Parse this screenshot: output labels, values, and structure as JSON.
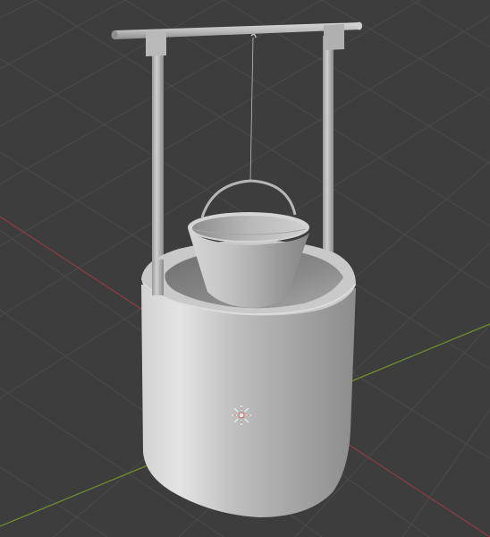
{
  "viewport": {
    "background_color": "#3d3d3d",
    "grid_line_color": "#4a4a4a",
    "x_axis_color": "#8a3a44",
    "y_axis_color": "#6d8a2e",
    "object_base_color": "#c4c4c4",
    "origin_marker_color": "#e8e8e8",
    "origin_marker_accent": "#c86464"
  },
  "scene": {
    "object": "well-with-bucket",
    "origin_icon": "object-origin-icon"
  }
}
